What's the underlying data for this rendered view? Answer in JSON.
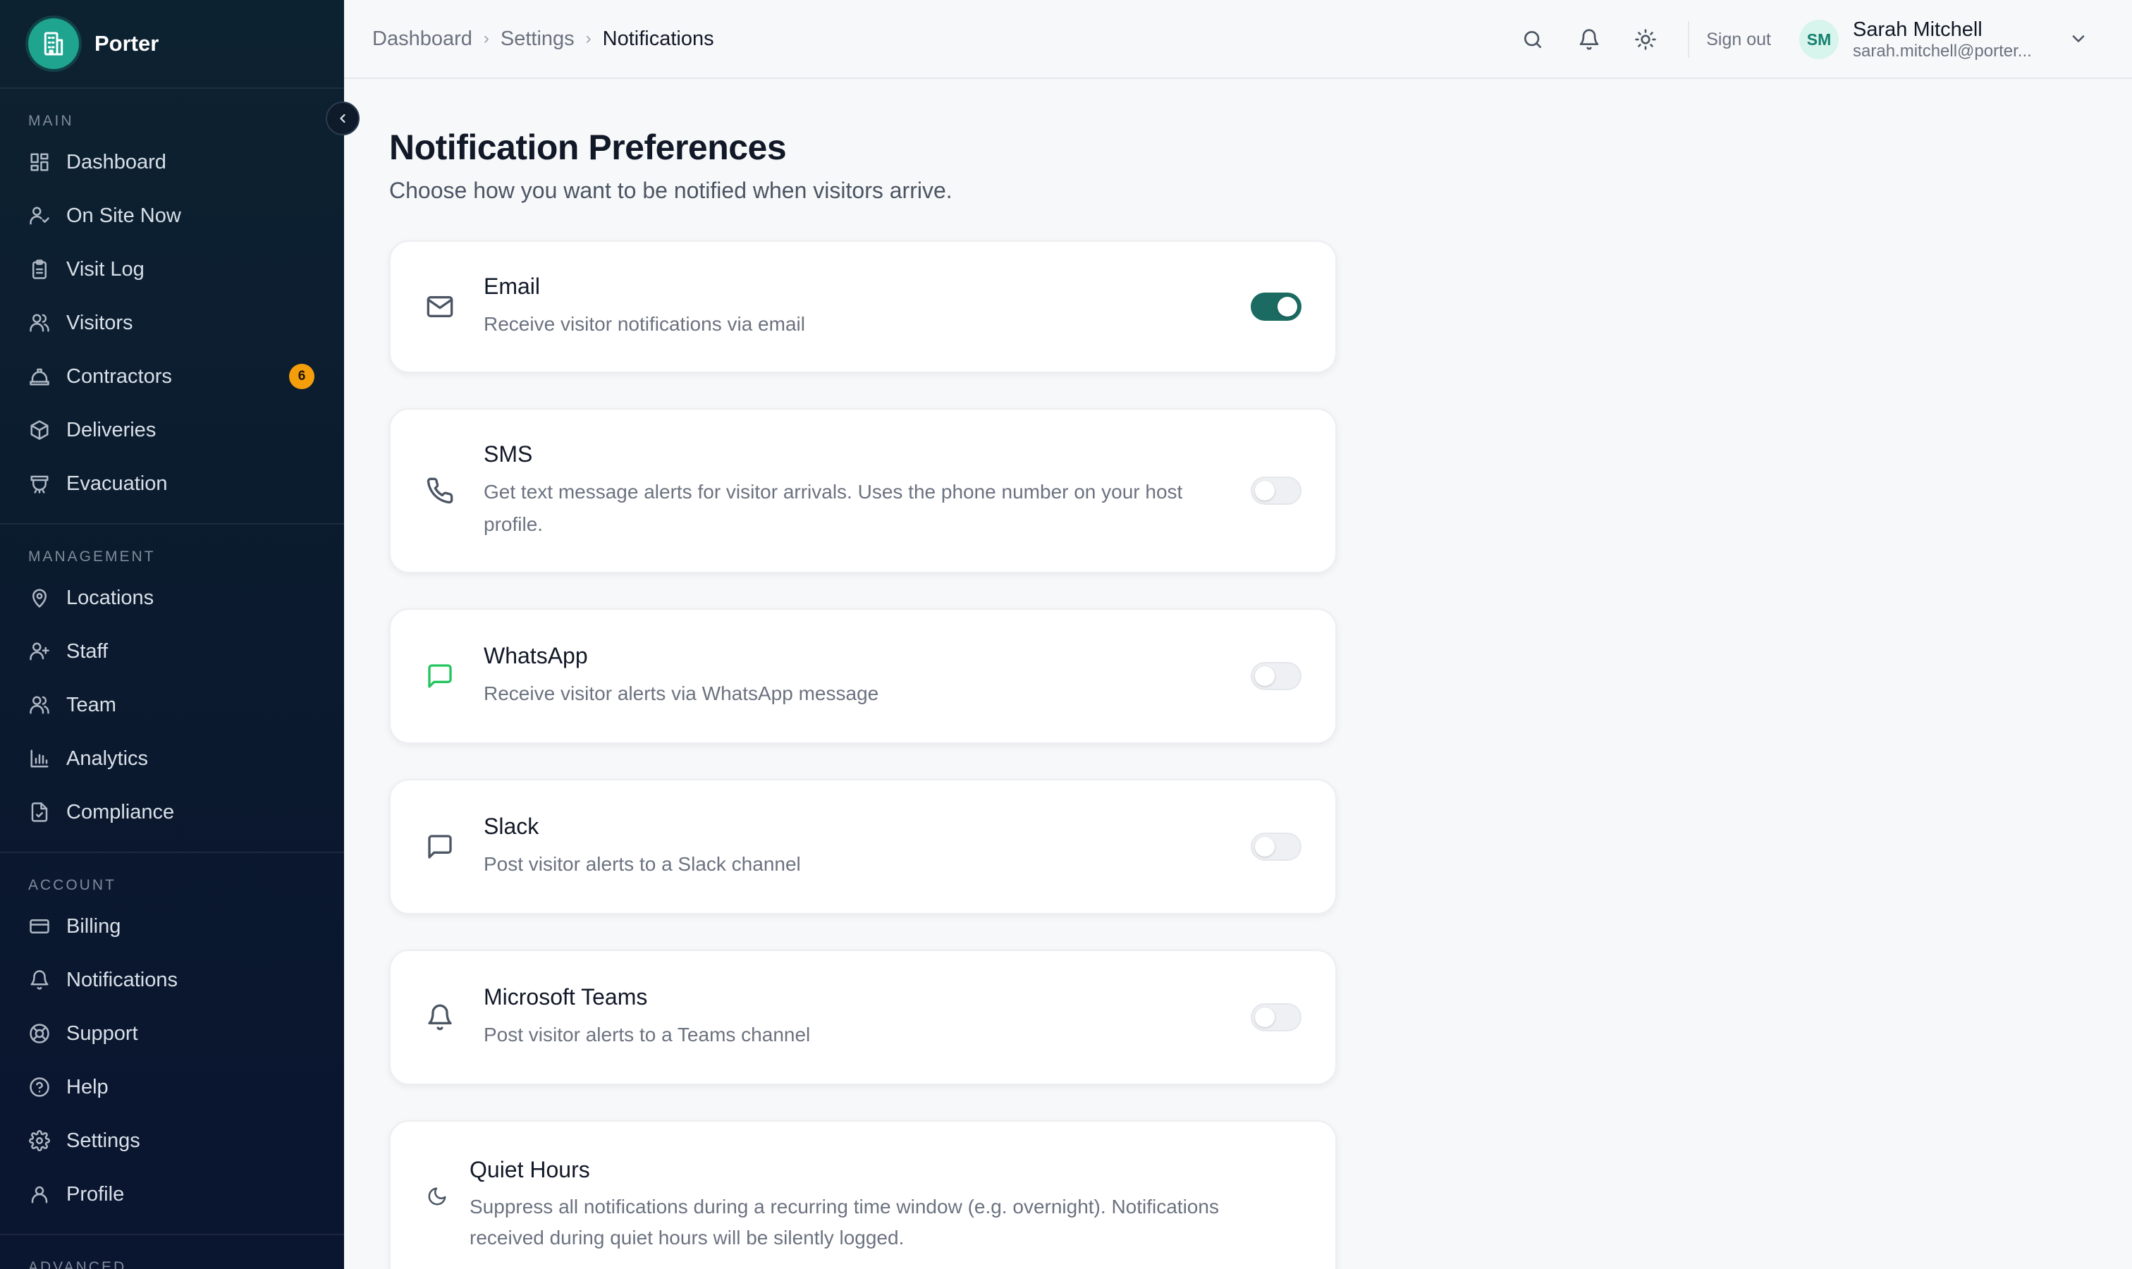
{
  "brand": {
    "name": "Porter"
  },
  "sidebar": {
    "sections": [
      {
        "title": "MAIN",
        "items": [
          {
            "label": "Dashboard",
            "icon": "dashboard-icon"
          },
          {
            "label": "On Site Now",
            "icon": "user-check-icon"
          },
          {
            "label": "Visit Log",
            "icon": "clipboard-icon"
          },
          {
            "label": "Visitors",
            "icon": "users-icon"
          },
          {
            "label": "Contractors",
            "icon": "hard-hat-icon",
            "badge": "6"
          },
          {
            "label": "Deliveries",
            "icon": "package-icon"
          },
          {
            "label": "Evacuation",
            "icon": "siren-icon"
          }
        ]
      },
      {
        "title": "MANAGEMENT",
        "items": [
          {
            "label": "Locations",
            "icon": "map-pin-icon"
          },
          {
            "label": "Staff",
            "icon": "user-plus-icon"
          },
          {
            "label": "Team",
            "icon": "users-icon"
          },
          {
            "label": "Analytics",
            "icon": "bar-chart-icon"
          },
          {
            "label": "Compliance",
            "icon": "file-check-icon"
          }
        ]
      },
      {
        "title": "ACCOUNT",
        "items": [
          {
            "label": "Billing",
            "icon": "credit-card-icon"
          },
          {
            "label": "Notifications",
            "icon": "bell-icon"
          },
          {
            "label": "Support",
            "icon": "life-buoy-icon"
          },
          {
            "label": "Help",
            "icon": "help-circle-icon"
          },
          {
            "label": "Settings",
            "icon": "gear-icon"
          },
          {
            "label": "Profile",
            "icon": "user-icon"
          }
        ]
      },
      {
        "title": "ADVANCED",
        "items": []
      }
    ]
  },
  "breadcrumb": {
    "items": [
      "Dashboard",
      "Settings",
      "Notifications"
    ]
  },
  "topbar": {
    "sign_out": "Sign out"
  },
  "user": {
    "initials": "SM",
    "name": "Sarah Mitchell",
    "email": "sarah.mitchell@porter..."
  },
  "page": {
    "title": "Notification Preferences",
    "subtitle": "Choose how you want to be notified when visitors arrive."
  },
  "channels": [
    {
      "title": "Email",
      "description": "Receive visitor notifications via email",
      "icon": "mail-icon",
      "enabled": true
    },
    {
      "title": "SMS",
      "description": "Get text message alerts for visitor arrivals. Uses the phone number on your host profile.",
      "icon": "phone-icon",
      "enabled": false
    },
    {
      "title": "WhatsApp",
      "description": "Receive visitor alerts via WhatsApp message",
      "icon": "message-icon",
      "enabled": false
    },
    {
      "title": "Slack",
      "description": "Post visitor alerts to a Slack channel",
      "icon": "chat-square-icon",
      "enabled": false
    },
    {
      "title": "Microsoft Teams",
      "description": "Post visitor alerts to a Teams channel",
      "icon": "bell-icon",
      "enabled": false
    }
  ],
  "quiet_hours": {
    "title": "Quiet Hours",
    "description": "Suppress all notifications during a recurring time window (e.g. overnight). Notifications received during quiet hours will be silently logged.",
    "icon": "moon-icon"
  },
  "colors": {
    "accent": "#1b6b62",
    "brand": "#1fa58f",
    "badge": "#f59e0b",
    "whatsapp": "#22c55e"
  }
}
